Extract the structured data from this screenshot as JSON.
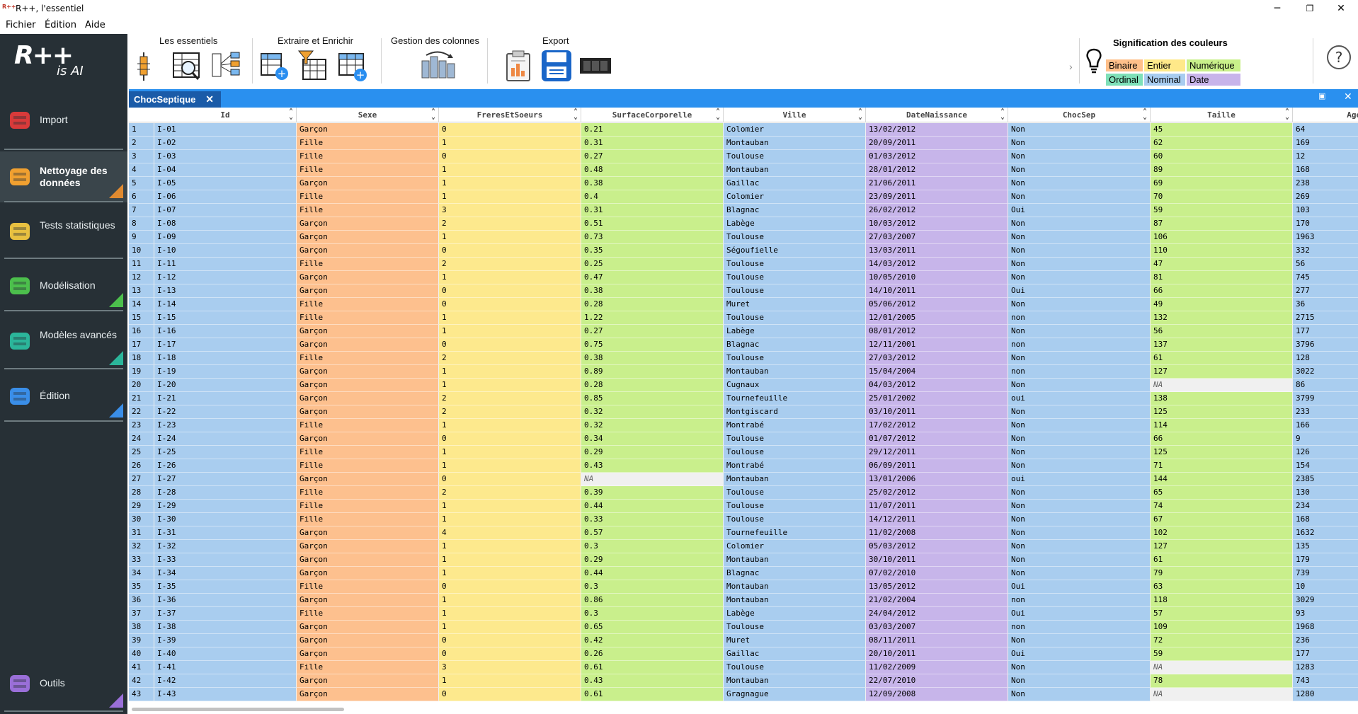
{
  "window": {
    "title": "R++, l'essentiel",
    "app_icon": "R++"
  },
  "menu": [
    "Fichier",
    "Édition",
    "Aide"
  ],
  "logo": {
    "main": "R++",
    "sub": "is AI"
  },
  "sidebar": [
    {
      "label": "Import",
      "icon": "database-import-icon",
      "corner": ""
    },
    {
      "label": "Nettoyage des données",
      "icon": "data-cleaning-icon",
      "corner": "#e08a30"
    },
    {
      "label": "Tests statistiques",
      "icon": "statistical-tests-icon",
      "corner": ""
    },
    {
      "label": "Modélisation",
      "icon": "modeling-scatter-icon",
      "corner": "#4cbf4c"
    },
    {
      "label": "Modèles avancés",
      "icon": "advanced-models-icon",
      "corner": "#2bb59a"
    },
    {
      "label": "Édition",
      "icon": "edition-chart-icon",
      "corner": "#3a8ee8"
    },
    {
      "label": "Outils",
      "icon": "tools-icon",
      "corner": "#9a6fd8"
    }
  ],
  "toolbar_groups": [
    "Les essentiels",
    "Extraire et Enrichir",
    "Gestion des colonnes",
    "Export"
  ],
  "legend": {
    "title": "Signification des couleurs",
    "items": [
      {
        "label": "Binaire",
        "color": "#ffc08a"
      },
      {
        "label": "Entier",
        "color": "#ffe989"
      },
      {
        "label": "Numérique",
        "color": "#c9f08a"
      },
      {
        "label": "Ordinal",
        "color": "#7ee0b8"
      },
      {
        "label": "Nominal",
        "color": "#a8ccf0"
      },
      {
        "label": "Date",
        "color": "#c8b4ea"
      }
    ]
  },
  "help_label": "?",
  "tab": {
    "label": "ChocSeptique",
    "close": "✕"
  },
  "columns": [
    {
      "name": "Id",
      "type": "nominal"
    },
    {
      "name": "Sexe",
      "type": "binary"
    },
    {
      "name": "FreresEtSoeurs",
      "type": "integer"
    },
    {
      "name": "SurfaceCorporelle",
      "type": "numeric"
    },
    {
      "name": "Ville",
      "type": "nominal"
    },
    {
      "name": "DateNaissance",
      "type": "date"
    },
    {
      "name": "ChocSep",
      "type": "nominal"
    },
    {
      "name": "Taille",
      "type": "numeric"
    },
    {
      "name": "AgeE",
      "type": "nominal"
    }
  ],
  "type_colors": {
    "nominal": "#a9cdef",
    "binary": "#fdc08e",
    "integer": "#fde98d",
    "numeric": "#c9ef8c",
    "date": "#c7b5ea",
    "na": "#f0f0f0"
  },
  "rows": [
    [
      "1",
      "I-01",
      "Garçon",
      "0",
      "0.21",
      "Colomier",
      "13/02/2012",
      "Non",
      "45",
      "64"
    ],
    [
      "2",
      "I-02",
      "Fille",
      "1",
      "0.31",
      "Montauban",
      "20/09/2011",
      "Non",
      "62",
      "169"
    ],
    [
      "3",
      "I-03",
      "Fille",
      "0",
      "0.27",
      "Toulouse",
      "01/03/2012",
      "Non",
      "60",
      "12"
    ],
    [
      "4",
      "I-04",
      "Fille",
      "1",
      "0.48",
      "Montauban",
      "28/01/2012",
      "Non",
      "89",
      "168"
    ],
    [
      "5",
      "I-05",
      "Garçon",
      "1",
      "0.38",
      "Gaillac",
      "21/06/2011",
      "Non",
      "69",
      "238"
    ],
    [
      "6",
      "I-06",
      "Fille",
      "1",
      "0.4",
      "Colomier",
      "23/09/2011",
      "Non",
      "70",
      "269"
    ],
    [
      "7",
      "I-07",
      "Fille",
      "3",
      "0.31",
      "Blagnac",
      "26/02/2012",
      "Oui",
      "59",
      "103"
    ],
    [
      "8",
      "I-08",
      "Garçon",
      "2",
      "0.51",
      "Labège",
      "10/03/2012",
      "Non",
      "87",
      "170"
    ],
    [
      "9",
      "I-09",
      "Garçon",
      "1",
      "0.73",
      "Toulouse",
      "27/03/2007",
      "Non",
      "106",
      "1963"
    ],
    [
      "10",
      "I-10",
      "Garçon",
      "0",
      "0.35",
      "Ségoufielle",
      "13/03/2011",
      "Non",
      "110",
      "332"
    ],
    [
      "11",
      "I-11",
      "Fille",
      "2",
      "0.25",
      "Toulouse",
      "14/03/2012",
      "Non",
      "47",
      "56"
    ],
    [
      "12",
      "I-12",
      "Garçon",
      "1",
      "0.47",
      "Toulouse",
      "10/05/2010",
      "Non",
      "81",
      "745"
    ],
    [
      "13",
      "I-13",
      "Garçon",
      "0",
      "0.38",
      "Toulouse",
      "14/10/2011",
      "Oui",
      "66",
      "277"
    ],
    [
      "14",
      "I-14",
      "Fille",
      "0",
      "0.28",
      "Muret",
      "05/06/2012",
      "Non",
      "49",
      "36"
    ],
    [
      "15",
      "I-15",
      "Fille",
      "1",
      "1.22",
      "Toulouse",
      "12/01/2005",
      "non",
      "132",
      "2715"
    ],
    [
      "16",
      "I-16",
      "Garçon",
      "1",
      "0.27",
      "Labège",
      "08/01/2012",
      "Non",
      "56",
      "177"
    ],
    [
      "17",
      "I-17",
      "Garçon",
      "0",
      "0.75",
      "Blagnac",
      "12/11/2001",
      "non",
      "137",
      "3796"
    ],
    [
      "18",
      "I-18",
      "Fille",
      "2",
      "0.38",
      "Toulouse",
      "27/03/2012",
      "Non",
      "61",
      "128"
    ],
    [
      "19",
      "I-19",
      "Garçon",
      "1",
      "0.89",
      "Montauban",
      "15/04/2004",
      "non",
      "127",
      "3022"
    ],
    [
      "20",
      "I-20",
      "Garçon",
      "1",
      "0.28",
      "Cugnaux",
      "04/03/2012",
      "Non",
      "NA",
      "86"
    ],
    [
      "21",
      "I-21",
      "Garçon",
      "2",
      "0.85",
      "Tournefeuille",
      "25/01/2002",
      "oui",
      "138",
      "3799"
    ],
    [
      "22",
      "I-22",
      "Garçon",
      "2",
      "0.32",
      "Montgiscard",
      "03/10/2011",
      "Non",
      "125",
      "233"
    ],
    [
      "23",
      "I-23",
      "Fille",
      "1",
      "0.32",
      "Montrabé",
      "17/02/2012",
      "Non",
      "114",
      "166"
    ],
    [
      "24",
      "I-24",
      "Garçon",
      "0",
      "0.34",
      "Toulouse",
      "01/07/2012",
      "Non",
      "66",
      "9"
    ],
    [
      "25",
      "I-25",
      "Fille",
      "1",
      "0.29",
      "Toulouse",
      "29/12/2011",
      "Non",
      "125",
      "126"
    ],
    [
      "26",
      "I-26",
      "Fille",
      "1",
      "0.43",
      "Montrabé",
      "06/09/2011",
      "Non",
      "71",
      "154"
    ],
    [
      "27",
      "I-27",
      "Garçon",
      "0",
      "NA",
      "Montauban",
      "13/01/2006",
      "oui",
      "144",
      "2385"
    ],
    [
      "28",
      "I-28",
      "Fille",
      "2",
      "0.39",
      "Toulouse",
      "25/02/2012",
      "Non",
      "65",
      "130"
    ],
    [
      "29",
      "I-29",
      "Fille",
      "1",
      "0.44",
      "Toulouse",
      "11/07/2011",
      "Non",
      "74",
      "234"
    ],
    [
      "30",
      "I-30",
      "Fille",
      "1",
      "0.33",
      "Toulouse",
      "14/12/2011",
      "Non",
      "67",
      "168"
    ],
    [
      "31",
      "I-31",
      "Garçon",
      "4",
      "0.57",
      "Tournefeuille",
      "11/02/2008",
      "Non",
      "102",
      "1632"
    ],
    [
      "32",
      "I-32",
      "Garçon",
      "1",
      "0.3",
      "Colomier",
      "05/03/2012",
      "Non",
      "127",
      "135"
    ],
    [
      "33",
      "I-33",
      "Garçon",
      "1",
      "0.29",
      "Montauban",
      "30/10/2011",
      "Non",
      "61",
      "179"
    ],
    [
      "34",
      "I-34",
      "Garçon",
      "1",
      "0.44",
      "Blagnac",
      "07/02/2010",
      "Non",
      "79",
      "739"
    ],
    [
      "35",
      "I-35",
      "Fille",
      "0",
      "0.3",
      "Montauban",
      "13/05/2012",
      "Oui",
      "63",
      "10"
    ],
    [
      "36",
      "I-36",
      "Garçon",
      "1",
      "0.86",
      "Montauban",
      "21/02/2004",
      "non",
      "118",
      "3029"
    ],
    [
      "37",
      "I-37",
      "Fille",
      "1",
      "0.3",
      "Labège",
      "24/04/2012",
      "Oui",
      "57",
      "93"
    ],
    [
      "38",
      "I-38",
      "Garçon",
      "1",
      "0.65",
      "Toulouse",
      "03/03/2007",
      "non",
      "109",
      "1968"
    ],
    [
      "39",
      "I-39",
      "Garçon",
      "0",
      "0.42",
      "Muret",
      "08/11/2011",
      "Non",
      "72",
      "236"
    ],
    [
      "40",
      "I-40",
      "Garçon",
      "0",
      "0.26",
      "Gaillac",
      "20/10/2011",
      "Oui",
      "59",
      "177"
    ],
    [
      "41",
      "I-41",
      "Fille",
      "3",
      "0.61",
      "Toulouse",
      "11/02/2009",
      "Non",
      "NA",
      "1283"
    ],
    [
      "42",
      "I-42",
      "Garçon",
      "1",
      "0.43",
      "Montauban",
      "22/07/2010",
      "Non",
      "78",
      "743"
    ],
    [
      "43",
      "I-43",
      "Garçon",
      "0",
      "0.61",
      "Gragnague",
      "12/09/2008",
      "Non",
      "NA",
      "1280"
    ]
  ]
}
